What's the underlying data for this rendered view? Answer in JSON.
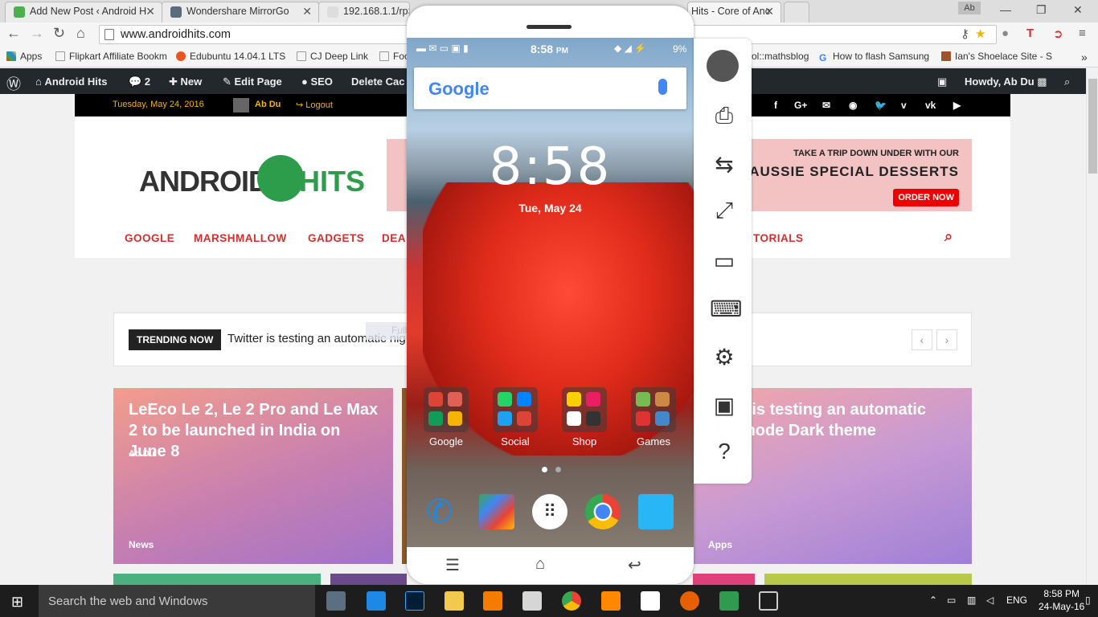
{
  "browser": {
    "tabs": [
      {
        "title": "Add New Post ‹ Android H",
        "favicon_color": "#4caf50"
      },
      {
        "title": "Wondershare MirrorGo",
        "favicon_color": "#5a6b7a"
      },
      {
        "title": "192.168.1.1/rpSys",
        "favicon_color": "#cccccc"
      },
      {
        "title": "Hits - Core of Anc",
        "favicon_color": "#2d9c4b"
      }
    ],
    "profile": "Ab",
    "url": "www.androidhits.com"
  },
  "bookmarks": {
    "apps_label": "Apps",
    "items": [
      "Flipkart Affiliate Bookm",
      "Edubuntu 14.04.1 LTS",
      "CJ Deep Link",
      "Foo",
      "ol::mathsblog",
      "How to flash Samsung",
      "Ian's Shoelace Site - S"
    ]
  },
  "wp_admin": {
    "site_name": "Android Hits",
    "comments": "2",
    "new": "New",
    "edit": "Edit Page",
    "seo": "SEO",
    "delete_cache": "Delete Cac",
    "howdy": "Howdy, Ab Du"
  },
  "site": {
    "date": "Tuesday, May 24, 2016",
    "user": "Ab Du",
    "logout": "Logout",
    "social_icons": [
      "f",
      "G+",
      "✉",
      "rss",
      "twitter",
      "vimeo",
      "vk",
      "youtube"
    ],
    "logo_left": "ANDROID",
    "logo_right": "HITS",
    "ad": {
      "line1": "TAKE A TRIP DOWN UNDER WITH OUR",
      "line2": "AUSSIE SPECIAL DESSERTS",
      "button": "ORDER NOW"
    },
    "menu": [
      "GOOGLE",
      "MARSHMALLOW",
      "GADGETS",
      "DEA",
      "TORIALS"
    ],
    "trending_label": "TRENDING NOW",
    "trending_text": "Twitter is testing an automatic nig",
    "snip_text": "Full-screen Snip",
    "cards": [
      {
        "title": "LeEco Le 2, Le 2 Pro and Le Max 2 to be launched in India on June 8",
        "author": "Ab Du",
        "category": "News"
      },
      {
        "title": "r is testing an automatic mode Dark theme",
        "author": "",
        "category": "Apps"
      }
    ]
  },
  "phone": {
    "status_time": "8:58",
    "status_ampm": "PM",
    "battery": "9%",
    "search_logo": "Google",
    "clock": "8:58",
    "date": "Tue, May 24",
    "folders": [
      "Google",
      "Social",
      "Shop",
      "Games"
    ]
  },
  "side_panel": {
    "icons": [
      "avatar",
      "camera-icon",
      "swap-icon",
      "fullscreen-icon",
      "video-icon",
      "keyboard-icon",
      "settings-icon",
      "file-icon",
      "help-icon"
    ]
  },
  "taskbar": {
    "search_placeholder": "Search the web and Windows",
    "lang": "ENG",
    "time": "8:58 PM",
    "date": "24-May-16"
  }
}
